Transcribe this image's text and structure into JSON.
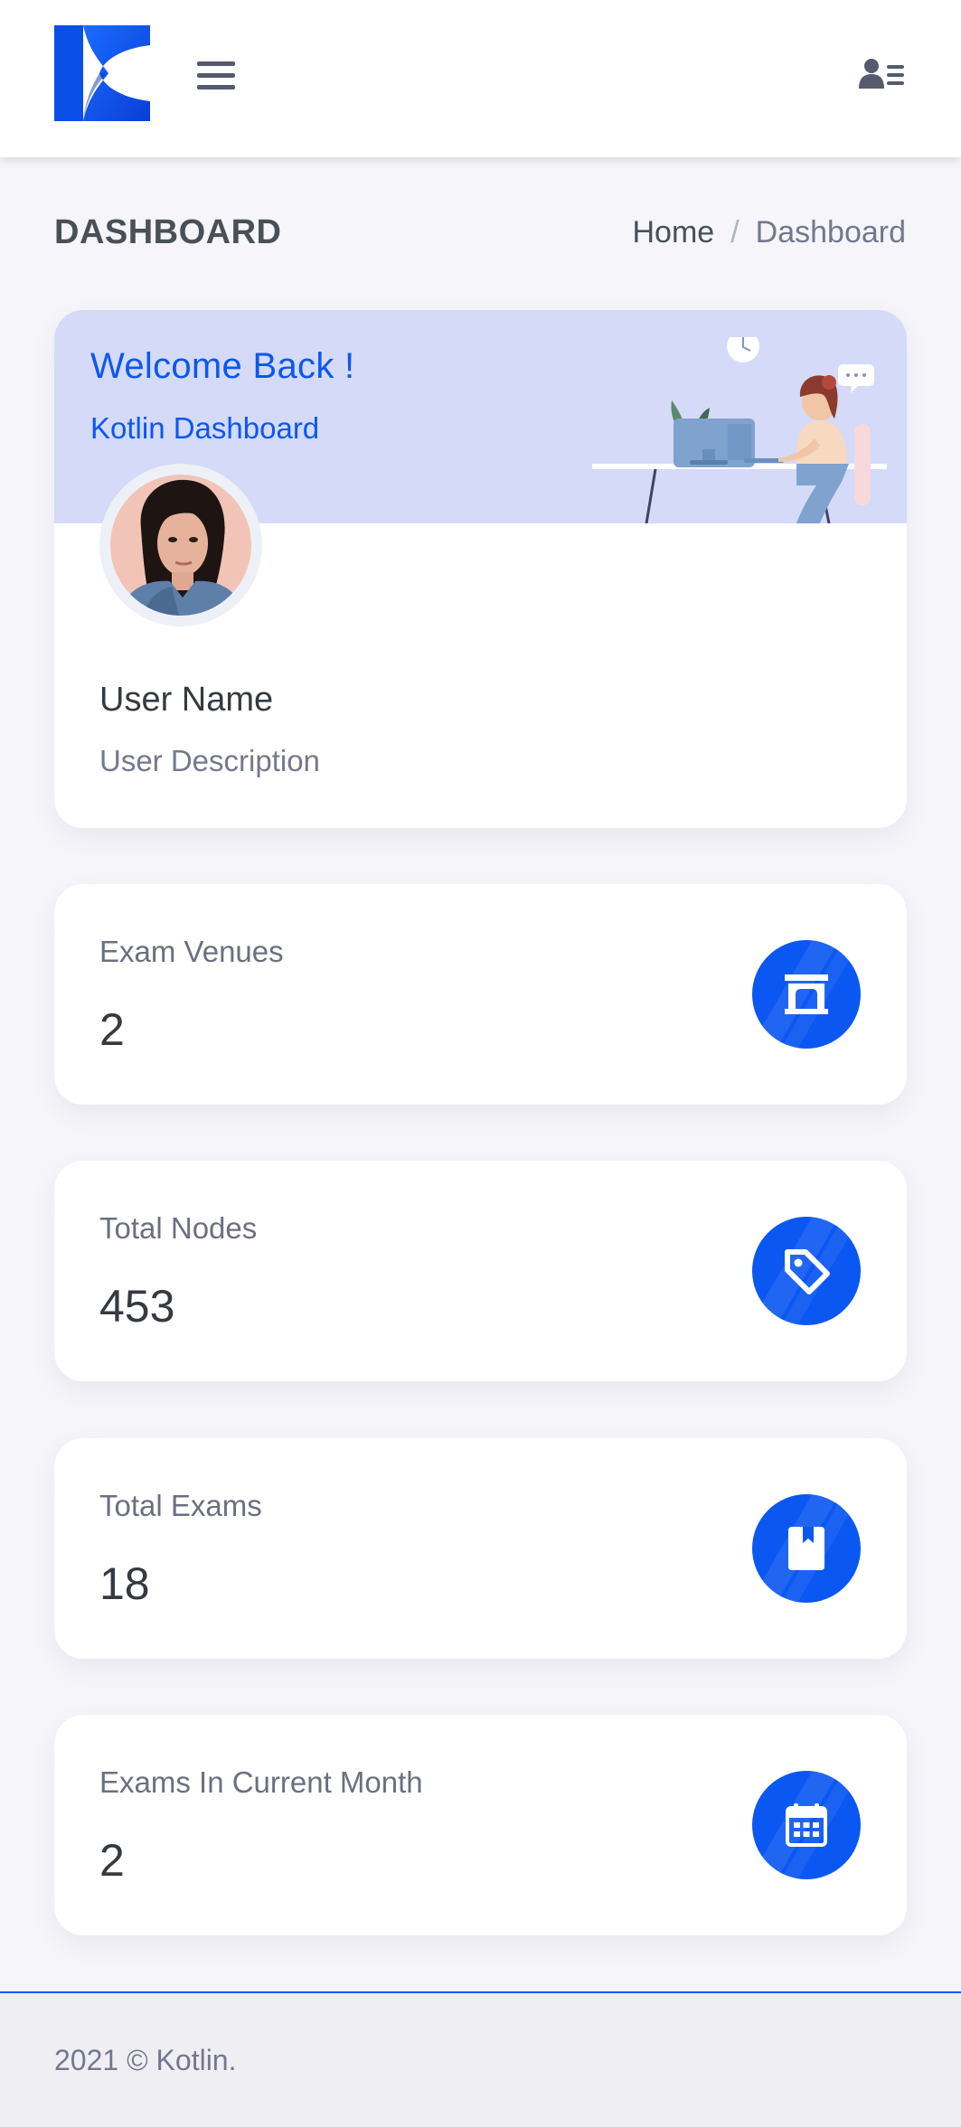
{
  "header": {
    "logo_icon": "kotlin-logo-icon",
    "menu_icon": "hamburger-menu-icon",
    "user_icon": "user-list-icon"
  },
  "page": {
    "title": "DASHBOARD",
    "breadcrumb": {
      "home": "Home",
      "separator": "/",
      "current": "Dashboard"
    }
  },
  "welcome": {
    "title": "Welcome Back !",
    "subtitle": "Kotlin Dashboard",
    "user_name": "User Name",
    "user_description": "User Description",
    "illustration": "woman-at-desk-illustration",
    "avatar": "user-avatar"
  },
  "stats": [
    {
      "label": "Exam Venues",
      "value": "2",
      "icon": "archway-icon"
    },
    {
      "label": "Total Nodes",
      "value": "453",
      "icon": "tag-icon"
    },
    {
      "label": "Total Exams",
      "value": "18",
      "icon": "book-icon"
    },
    {
      "label": "Exams In Current Month",
      "value": "2",
      "icon": "calendar-icon"
    }
  ],
  "footer": {
    "text": "2021 © Kotlin."
  },
  "colors": {
    "accent": "#0b57f2",
    "welcome_bg": "#d4daf8",
    "page_bg": "#f5f5fa",
    "footer_bg": "#efeff3"
  }
}
